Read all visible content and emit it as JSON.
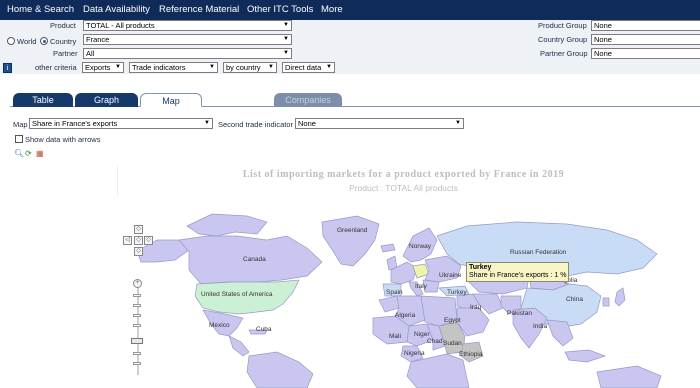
{
  "nav": {
    "items": [
      "Home & Search",
      "Data Availability",
      "Reference Material",
      "Other ITC Tools",
      "More"
    ]
  },
  "criteria": {
    "product_label": "Product",
    "product_value": "TOTAL - All products",
    "world_label": "World",
    "country_label": "Country",
    "country_value": "France",
    "partner_label": "Partner",
    "partner_value": "All",
    "other_label": "other criteria",
    "trade_flow": "Exports",
    "indicator_type": "Trade indicators",
    "grouping": "by country",
    "data_source": "Direct data",
    "product_group_label": "Product Group",
    "product_group_value": "None",
    "country_group_label": "Country Group",
    "country_group_value": "None",
    "partner_group_label": "Partner Group",
    "partner_group_value": "None",
    "info_icon": "info-icon"
  },
  "tabs": {
    "table": "Table",
    "graph": "Graph",
    "map": "Map",
    "companies": "Companies"
  },
  "map_options": {
    "map_label": "Map",
    "map_value": "Share in France's exports",
    "second_label": "Second trade indicator",
    "second_value": "None",
    "arrows_label": "Show data with arrows",
    "tool_icons": [
      "zoom-icon",
      "refresh-icon",
      "export-icon"
    ]
  },
  "map": {
    "title": "List of importing markets for a product exported by France in 2019",
    "subtitle": "Product : TOTAL All products",
    "countries": [
      "Greenland",
      "Norway",
      "Russian Federation",
      "Canada",
      "Ukraine",
      "Mongolia",
      "United States of America",
      "Spain",
      "Italy",
      "Turkey",
      "China",
      "Iraq",
      "Pakistan",
      "Mexico",
      "Algeria",
      "Egypt",
      "India",
      "Cuba",
      "Mali",
      "Niger",
      "Chad",
      "Sudan",
      "Nigeria",
      "Ethiopia"
    ],
    "tooltip_country": "Turkey",
    "tooltip_text": "Share in France's exports : 1 %",
    "colors": {
      "ocean": "#ffffff",
      "land_default": "#c9c6f0",
      "land_light": "#c9dcf5",
      "land_green": "#ccf0d4",
      "land_highlight": "#eef5a8",
      "land_gray": "#c4c4c4",
      "border": "#9999c8"
    }
  }
}
